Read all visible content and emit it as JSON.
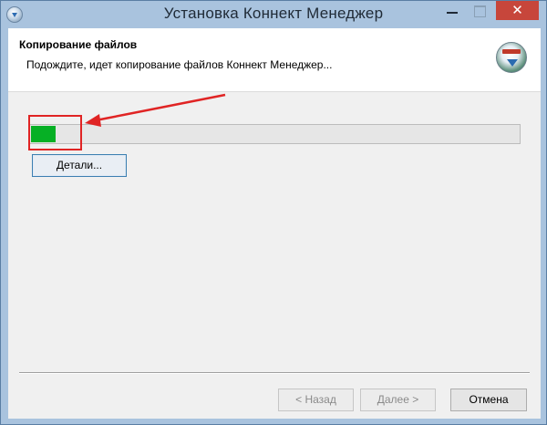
{
  "window": {
    "title": "Установка Коннект Менеджер",
    "close_glyph": "✕"
  },
  "header": {
    "title": "Копирование файлов",
    "subtitle": "Подождите, идет копирование файлов Коннект Менеджер...",
    "logo_icon": "installer-logo-icon"
  },
  "progress": {
    "value_percent": 5,
    "fill_color": "#06b025"
  },
  "annotation": {
    "highlight_color": "#e02424",
    "arrow_color": "#e02424"
  },
  "buttons": {
    "details": "Детали...",
    "back": "< Назад",
    "next": "Далее >",
    "cancel": "Отмена"
  }
}
